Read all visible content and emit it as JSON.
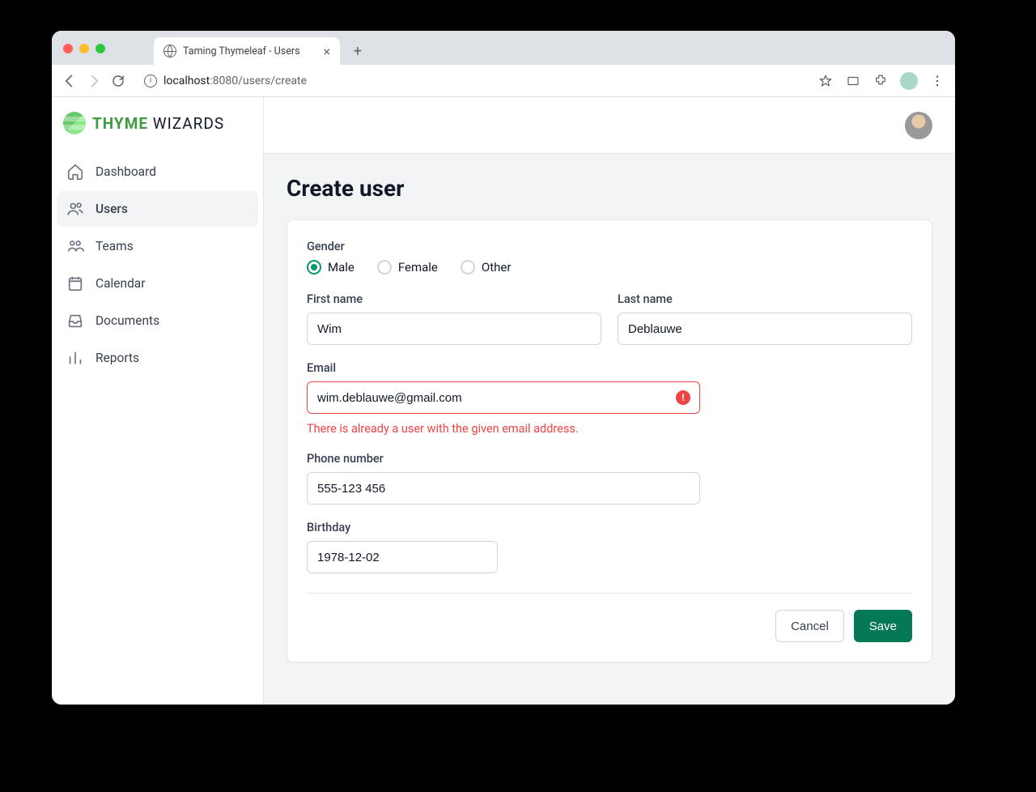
{
  "browser": {
    "tab_title": "Taming Thymeleaf - Users",
    "url_host": "localhost",
    "url_port_path": ":8080/users/create"
  },
  "brand": {
    "bold": "THYME",
    "rest": " WIZARDS"
  },
  "sidebar": {
    "items": [
      {
        "label": "Dashboard"
      },
      {
        "label": "Users"
      },
      {
        "label": "Teams"
      },
      {
        "label": "Calendar"
      },
      {
        "label": "Documents"
      },
      {
        "label": "Reports"
      }
    ]
  },
  "page": {
    "title": "Create user"
  },
  "form": {
    "gender_label": "Gender",
    "gender_options": {
      "male": "Male",
      "female": "Female",
      "other": "Other"
    },
    "first_name_label": "First name",
    "first_name_value": "Wim",
    "last_name_label": "Last name",
    "last_name_value": "Deblauwe",
    "email_label": "Email",
    "email_value": "wim.deblauwe@gmail.com",
    "email_error": "There is already a user with the given email address.",
    "phone_label": "Phone number",
    "phone_value": "555-123 456",
    "birthday_label": "Birthday",
    "birthday_value": "1978-12-02"
  },
  "actions": {
    "cancel": "Cancel",
    "save": "Save"
  }
}
